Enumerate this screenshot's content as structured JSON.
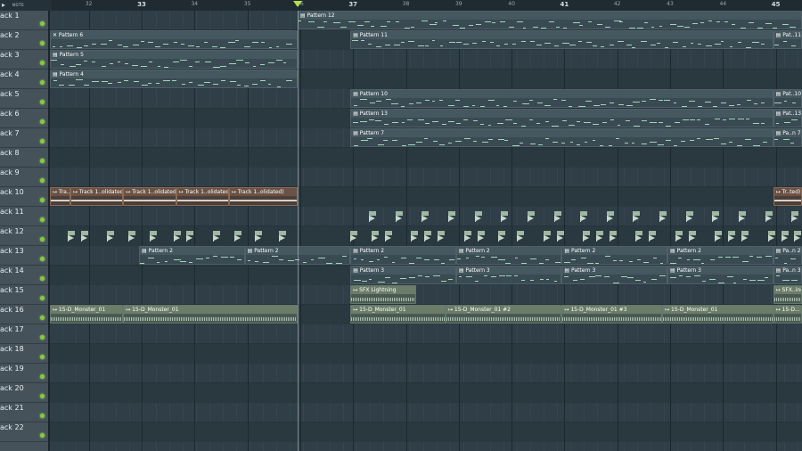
{
  "ruler": {
    "pointer_icon": "arrow-pointer-icon",
    "mode_text": "NOTE",
    "ticks": [
      {
        "label": "32",
        "bar": 32
      },
      {
        "label": "33",
        "bar": 33
      },
      {
        "label": "34",
        "bar": 34
      },
      {
        "label": "35",
        "bar": 35
      },
      {
        "label": "36",
        "bar": 36
      },
      {
        "label": "37",
        "bar": 37
      },
      {
        "label": "38",
        "bar": 38
      },
      {
        "label": "39",
        "bar": 39
      },
      {
        "label": "40",
        "bar": 40
      },
      {
        "label": "41",
        "bar": 41
      },
      {
        "label": "42",
        "bar": 42
      },
      {
        "label": "43",
        "bar": 43
      },
      {
        "label": "44",
        "bar": 44
      },
      {
        "label": "45",
        "bar": 45
      }
    ],
    "playhead_bar": 35.95
  },
  "tracks": [
    {
      "label": "ack 1"
    },
    {
      "label": "ack 2"
    },
    {
      "label": "ack 3"
    },
    {
      "label": "ack 4"
    },
    {
      "label": "ack 5"
    },
    {
      "label": "ack 6"
    },
    {
      "label": "ack 7"
    },
    {
      "label": "ack 8"
    },
    {
      "label": "ack 9"
    },
    {
      "label": "ack 10"
    },
    {
      "label": "ack 11"
    },
    {
      "label": "ack 12"
    },
    {
      "label": "ack 13"
    },
    {
      "label": "ack 14"
    },
    {
      "label": "ack 15"
    },
    {
      "label": "ack 16"
    },
    {
      "label": "ack 17"
    },
    {
      "label": "ack 18"
    },
    {
      "label": "ack 19"
    },
    {
      "label": "ack 20"
    },
    {
      "label": "ack 21"
    },
    {
      "label": "ack 22"
    }
  ],
  "clips": [
    {
      "track": 1,
      "start": 35.95,
      "end": 46,
      "type": "pattern",
      "label": "▤ Pattern 12"
    },
    {
      "track": 2,
      "start": 31,
      "end": 35.95,
      "type": "pattern",
      "label": "✕ Pattern 6"
    },
    {
      "track": 2,
      "start": 36.95,
      "end": 44.95,
      "type": "pattern",
      "label": "▤ Pattern 11"
    },
    {
      "track": 2,
      "start": 44.95,
      "end": 46,
      "type": "pattern",
      "label": "▤ Pat..11"
    },
    {
      "track": 3,
      "start": 31,
      "end": 35.95,
      "type": "pattern",
      "label": "▤ Pattern 5"
    },
    {
      "track": 4,
      "start": 31,
      "end": 35.95,
      "type": "pattern",
      "label": "▤ Pattern 4"
    },
    {
      "track": 5,
      "start": 36.95,
      "end": 44.95,
      "type": "pattern",
      "label": "▤ Pattern 10"
    },
    {
      "track": 5,
      "start": 44.95,
      "end": 46,
      "type": "pattern",
      "label": "▤ Pat..10"
    },
    {
      "track": 6,
      "start": 36.95,
      "end": 44.95,
      "type": "pattern",
      "label": "▤ Pattern 13"
    },
    {
      "track": 6,
      "start": 44.95,
      "end": 46,
      "type": "pattern",
      "label": "▤ Pat..13"
    },
    {
      "track": 7,
      "start": 36.95,
      "end": 44.95,
      "type": "pattern",
      "label": "▤ Pattern 7"
    },
    {
      "track": 7,
      "start": 44.95,
      "end": 46,
      "type": "pattern",
      "label": "▤ Pa..n 7"
    },
    {
      "track": 10,
      "start": 31,
      "end": 31.65,
      "type": "consolidated",
      "label": "↦ Tra..ated)"
    },
    {
      "track": 10,
      "start": 31.65,
      "end": 32.65,
      "type": "consolidated",
      "label": "↦ Track 1..olidated)"
    },
    {
      "track": 10,
      "start": 32.65,
      "end": 33.65,
      "type": "consolidated",
      "label": "↦ Track 1..olidated)"
    },
    {
      "track": 10,
      "start": 33.65,
      "end": 34.65,
      "type": "consolidated",
      "label": "↦ Track 1..olidated)"
    },
    {
      "track": 10,
      "start": 34.65,
      "end": 35.95,
      "type": "consolidated",
      "label": "↦ Track 1..olidated)"
    },
    {
      "track": 10,
      "start": 44.95,
      "end": 46,
      "type": "consolidated",
      "label": "↦ Tr..ted)"
    },
    {
      "track": 13,
      "start": 32.95,
      "end": 34.95,
      "type": "pattern",
      "label": "▤ Pattern 2"
    },
    {
      "track": 13,
      "start": 34.95,
      "end": 36.95,
      "type": "pattern",
      "label": "▤ Pattern 2"
    },
    {
      "track": 13,
      "start": 36.95,
      "end": 38.95,
      "type": "pattern",
      "label": "▤ Pattern 2"
    },
    {
      "track": 13,
      "start": 38.95,
      "end": 40.95,
      "type": "pattern",
      "label": "▤ Pattern 2"
    },
    {
      "track": 13,
      "start": 40.95,
      "end": 42.95,
      "type": "pattern",
      "label": "▤ Pattern 2"
    },
    {
      "track": 13,
      "start": 42.95,
      "end": 44.95,
      "type": "pattern",
      "label": "▤ Pattern 2"
    },
    {
      "track": 13,
      "start": 44.95,
      "end": 46,
      "type": "pattern",
      "label": "▤ Pa..n 2"
    },
    {
      "track": 14,
      "start": 36.95,
      "end": 38.95,
      "type": "pattern",
      "label": "▤ Pattern 3"
    },
    {
      "track": 14,
      "start": 38.95,
      "end": 40.95,
      "type": "pattern",
      "label": "▤ Pattern 3"
    },
    {
      "track": 14,
      "start": 40.95,
      "end": 42.95,
      "type": "pattern",
      "label": "▤ Pattern 3"
    },
    {
      "track": 14,
      "start": 42.95,
      "end": 44.95,
      "type": "pattern",
      "label": "▤ Pattern 3"
    },
    {
      "track": 14,
      "start": 44.95,
      "end": 46,
      "type": "pattern",
      "label": "▤ Pa..n 3"
    },
    {
      "track": 15,
      "start": 36.95,
      "end": 38.2,
      "type": "audio",
      "label": "↦ SFX Lightning"
    },
    {
      "track": 15,
      "start": 44.95,
      "end": 46,
      "type": "audio",
      "label": "↦ SFX..ing"
    },
    {
      "track": 16,
      "start": 31,
      "end": 32.65,
      "type": "audio",
      "label": "↦ 15-D_Monster_01"
    },
    {
      "track": 16,
      "start": 32.65,
      "end": 35.95,
      "type": "audio",
      "label": "↦ 15-D_Monster_01"
    },
    {
      "track": 16,
      "start": 36.95,
      "end": 38.75,
      "type": "audio",
      "label": "↦ 15-D_Monster_01"
    },
    {
      "track": 16,
      "start": 38.75,
      "end": 40.95,
      "type": "audio",
      "label": "↦ 15-D_Monster_01 #2"
    },
    {
      "track": 16,
      "start": 40.95,
      "end": 42.85,
      "type": "audio",
      "label": "↦ 15-D_Monster_01 #3"
    },
    {
      "track": 16,
      "start": 42.85,
      "end": 44.95,
      "type": "audio",
      "label": "↦ 15-D_Monster_01"
    },
    {
      "track": 16,
      "start": 44.95,
      "end": 46,
      "type": "audio",
      "label": "↦ 15-D..."
    }
  ],
  "markers": {
    "track11_bars": [
      37.3,
      37.8,
      38.3,
      38.8,
      39.3,
      39.8,
      40.3,
      40.8,
      41.3,
      41.8,
      42.3,
      42.8,
      43.3,
      43.8,
      44.3,
      44.8,
      45.3
    ],
    "track12_bars": [
      31.05,
      31.6,
      31.85,
      32.35,
      32.75,
      33.15,
      33.6,
      33.85,
      34.35,
      34.75,
      35.15,
      35.6,
      36.95,
      37.35,
      37.6,
      38.1,
      38.35,
      38.6,
      39.1,
      39.35,
      39.75,
      40.1,
      40.6,
      40.85,
      41.35,
      41.6,
      41.85,
      42.35,
      42.6,
      43.1,
      43.35,
      43.85,
      44.1,
      44.35,
      44.85,
      45.1,
      45.35
    ]
  }
}
